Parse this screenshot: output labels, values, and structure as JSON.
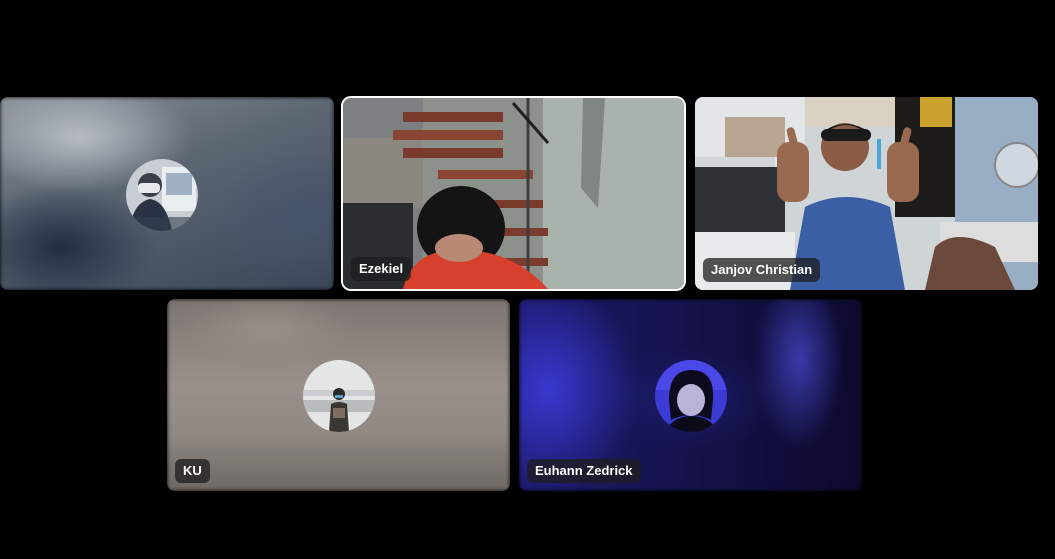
{
  "participants": [
    {
      "name": "",
      "video_on": false,
      "avatar": "participant-photo"
    },
    {
      "name": "Ezekiel",
      "video_on": true,
      "active_speaker": true
    },
    {
      "name": "Janjov Christian",
      "video_on": true
    },
    {
      "name": "KU",
      "video_on": false,
      "avatar": "participant-photo"
    },
    {
      "name": "Euhann Zedrick",
      "video_on": false,
      "avatar": "participant-photo"
    }
  ],
  "colors": {
    "background": "#000000",
    "active_speaker_border": "#ffffff",
    "name_tag_bg": "#1e1e1e",
    "name_tag_text": "#ffffff"
  }
}
